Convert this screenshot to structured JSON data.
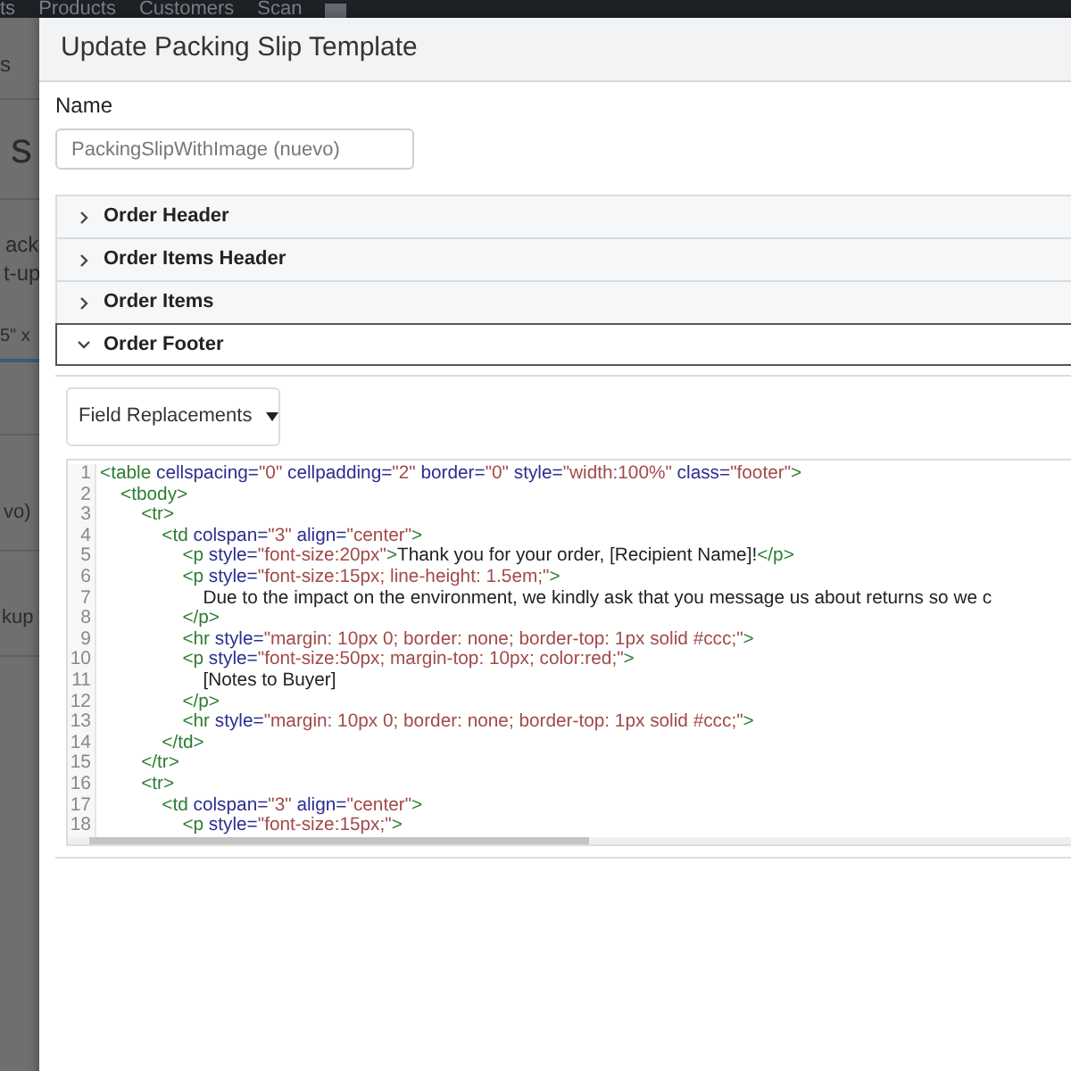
{
  "nav": {
    "items": [
      "ts",
      "Products",
      "Customers",
      "Scan"
    ]
  },
  "background_page": {
    "texts": [
      "s",
      "s",
      "ack",
      "t-up",
      "5\" x",
      "vo)",
      "kup"
    ]
  },
  "dialog": {
    "title": "Update Packing Slip Template",
    "name_label": "Name",
    "name_value": "PackingSlipWithImage (nuevo)",
    "sections": [
      {
        "label": "Order Header",
        "expanded": false
      },
      {
        "label": "Order Items Header",
        "expanded": false
      },
      {
        "label": "Order Items",
        "expanded": false
      },
      {
        "label": "Order Footer",
        "expanded": true
      }
    ],
    "field_replacements": {
      "label": "Field Replacements"
    },
    "editor": {
      "lines": [
        {
          "number": "1",
          "tokens": [
            {
              "kind": "tag",
              "text": "<table"
            },
            {
              "kind": "attr",
              "text": " cellspacing="
            },
            {
              "kind": "value",
              "text": "\"0\""
            },
            {
              "kind": "attr",
              "text": " cellpadding="
            },
            {
              "kind": "value",
              "text": "\"2\""
            },
            {
              "kind": "attr",
              "text": " border="
            },
            {
              "kind": "value",
              "text": "\"0\""
            },
            {
              "kind": "attr",
              "text": " style="
            },
            {
              "kind": "value",
              "text": "\"width:100%\""
            },
            {
              "kind": "attr",
              "text": " class="
            },
            {
              "kind": "value",
              "text": "\"footer\""
            },
            {
              "kind": "tag",
              "text": ">"
            }
          ]
        },
        {
          "number": "2",
          "tokens": [
            {
              "kind": "tag",
              "text": "    <tbody>"
            }
          ]
        },
        {
          "number": "3",
          "tokens": [
            {
              "kind": "tag",
              "text": "        <tr>"
            }
          ]
        },
        {
          "number": "4",
          "tokens": [
            {
              "kind": "tag",
              "text": "            <td"
            },
            {
              "kind": "attr",
              "text": " colspan="
            },
            {
              "kind": "value",
              "text": "\"3\""
            },
            {
              "kind": "attr",
              "text": " align="
            },
            {
              "kind": "value",
              "text": "\"center\""
            },
            {
              "kind": "tag",
              "text": ">"
            }
          ]
        },
        {
          "number": "5",
          "tokens": [
            {
              "kind": "tag",
              "text": "                <p"
            },
            {
              "kind": "attr",
              "text": " style="
            },
            {
              "kind": "value",
              "text": "\"font-size:20px\""
            },
            {
              "kind": "tag",
              "text": ">"
            },
            {
              "kind": "text",
              "text": "Thank you for your order, [Recipient Name]!"
            },
            {
              "kind": "tag",
              "text": "</p>"
            }
          ]
        },
        {
          "number": "6",
          "tokens": [
            {
              "kind": "tag",
              "text": "                <p"
            },
            {
              "kind": "attr",
              "text": " style="
            },
            {
              "kind": "value",
              "text": "\"font-size:15px; line-height: 1.5em;\""
            },
            {
              "kind": "tag",
              "text": ">"
            }
          ]
        },
        {
          "number": "7",
          "tokens": [
            {
              "kind": "text",
              "text": "                    Due to the impact on the environment, we kindly ask that you message us about returns so we c"
            }
          ]
        },
        {
          "number": "8",
          "tokens": [
            {
              "kind": "tag",
              "text": "                </p>"
            }
          ]
        },
        {
          "number": "9",
          "tokens": [
            {
              "kind": "tag",
              "text": "                <hr"
            },
            {
              "kind": "attr",
              "text": " style="
            },
            {
              "kind": "value",
              "text": "\"margin: 10px 0; border: none; border-top: 1px solid #ccc;\""
            },
            {
              "kind": "tag",
              "text": ">"
            }
          ]
        },
        {
          "number": "10",
          "tokens": [
            {
              "kind": "tag",
              "text": "                <p"
            },
            {
              "kind": "attr",
              "text": " style="
            },
            {
              "kind": "value",
              "text": "\"font-size:50px; margin-top: 10px; color:red;\""
            },
            {
              "kind": "tag",
              "text": ">"
            }
          ]
        },
        {
          "number": "11",
          "tokens": [
            {
              "kind": "text",
              "text": "                    [Notes to Buyer]"
            }
          ]
        },
        {
          "number": "12",
          "tokens": [
            {
              "kind": "tag",
              "text": "                </p>"
            }
          ]
        },
        {
          "number": "13",
          "tokens": [
            {
              "kind": "tag",
              "text": "                <hr"
            },
            {
              "kind": "attr",
              "text": " style="
            },
            {
              "kind": "value",
              "text": "\"margin: 10px 0; border: none; border-top: 1px solid #ccc;\""
            },
            {
              "kind": "tag",
              "text": ">"
            }
          ]
        },
        {
          "number": "14",
          "tokens": [
            {
              "kind": "tag",
              "text": "            </td>"
            }
          ]
        },
        {
          "number": "15",
          "tokens": [
            {
              "kind": "tag",
              "text": "        </tr>"
            }
          ]
        },
        {
          "number": "16",
          "tokens": [
            {
              "kind": "tag",
              "text": "        <tr>"
            }
          ]
        },
        {
          "number": "17",
          "tokens": [
            {
              "kind": "tag",
              "text": "            <td"
            },
            {
              "kind": "attr",
              "text": " colspan="
            },
            {
              "kind": "value",
              "text": "\"3\""
            },
            {
              "kind": "attr",
              "text": " align="
            },
            {
              "kind": "value",
              "text": "\"center\""
            },
            {
              "kind": "tag",
              "text": ">"
            }
          ]
        },
        {
          "number": "18",
          "tokens": [
            {
              "kind": "tag",
              "text": "                <p"
            },
            {
              "kind": "attr",
              "text": " style="
            },
            {
              "kind": "value",
              "text": "\"font-size:15px;\""
            },
            {
              "kind": "tag",
              "text": ">"
            }
          ]
        }
      ]
    }
  }
}
